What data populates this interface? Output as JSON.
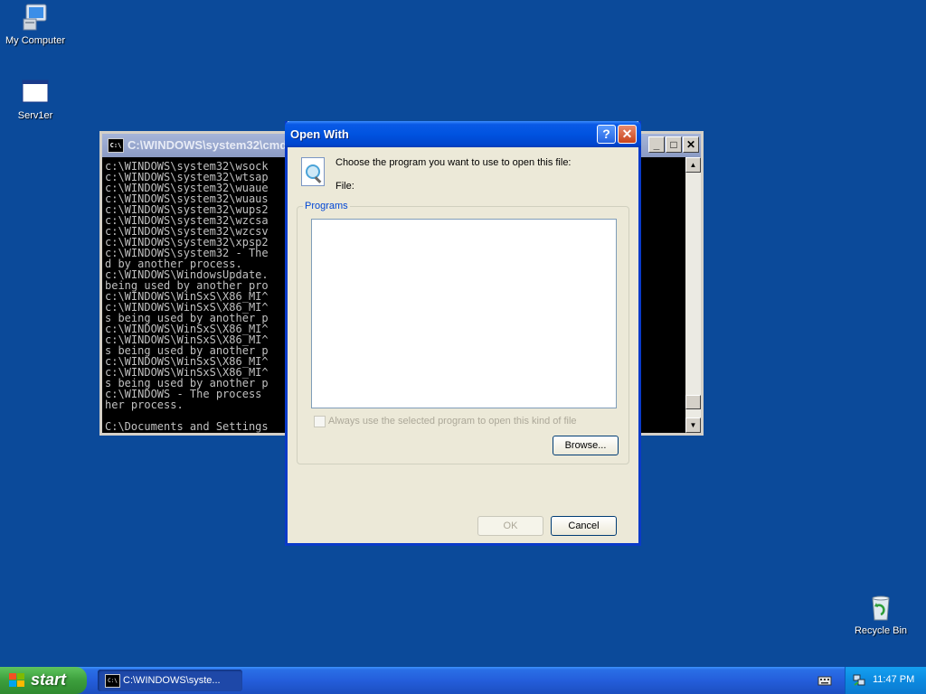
{
  "desktop": {
    "icons": [
      {
        "label": "My Computer"
      },
      {
        "label": "Serv1er"
      },
      {
        "label": "Recycle Bin"
      }
    ]
  },
  "console": {
    "title": "C:\\WINDOWS\\system32\\cmd",
    "icon": "console-icon",
    "lines": [
      "c:\\WINDOWS\\system32\\wsock                                             ",
      "c:\\WINDOWS\\system32\\wtsap",
      "c:\\WINDOWS\\system32\\wuaue",
      "c:\\WINDOWS\\system32\\wuaus",
      "c:\\WINDOWS\\system32\\wups2",
      "c:\\WINDOWS\\system32\\wzcsa",
      "c:\\WINDOWS\\system32\\wzcsv",
      "c:\\WINDOWS\\system32\\xpsp2",
      "c:\\WINDOWS\\system32 - The                                    ng use",
      "d by another process.",
      "c:\\WINDOWS\\WindowsUpdate.                                    it is",
      "being used by another pro",
      "c:\\WINDOWS\\WinSxS\\X86_MI^",
      "c:\\WINDOWS\\WinSxS\\X86_MI^                                    e it i",
      "s being used by another p",
      "c:\\WINDOWS\\WinSxS\\X86_MI^",
      "c:\\WINDOWS\\WinSxS\\X86_MI^                                    e it i",
      "s being used by another p",
      "c:\\WINDOWS\\WinSxS\\X86_MI^",
      "c:\\WINDOWS\\WinSxS\\X86_MI^                                    e it i",
      "s being used by another p",
      "c:\\WINDOWS - The process                                      y anot",
      "her process.",
      "",
      "C:\\Documents and Settings"
    ]
  },
  "dialog": {
    "title": "Open With",
    "help_label": "?",
    "close_label": "✕",
    "instruction": "Choose the program you want to use to open this file:",
    "file_label": "File:",
    "programs_legend": "Programs",
    "always_use_label": "Always use the selected program to open this kind of file",
    "browse_label": "Browse...",
    "ok_label": "OK",
    "cancel_label": "Cancel"
  },
  "taskbar": {
    "start_label": "start",
    "task_label": "C:\\WINDOWS\\syste...",
    "clock": "11:47 PM"
  }
}
